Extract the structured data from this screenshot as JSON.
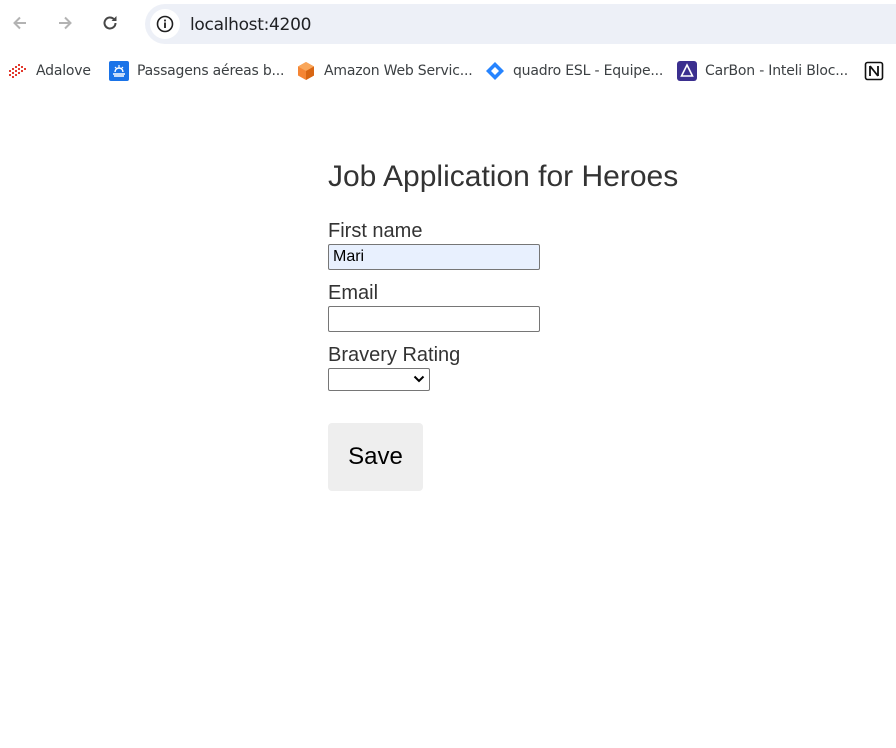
{
  "browser": {
    "url": "localhost:4200",
    "bookmarks": [
      {
        "label": "Adalove",
        "icon": "adalove-icon"
      },
      {
        "label": "Passagens aéreas b...",
        "icon": "flight-icon"
      },
      {
        "label": "Amazon Web Servic...",
        "icon": "aws-cube-icon"
      },
      {
        "label": "quadro ESL - Equipe...",
        "icon": "jira-diamond-icon"
      },
      {
        "label": "CarBon - Inteli Bloc...",
        "icon": "carbon-triangle-icon"
      },
      {
        "label": "",
        "icon": "notion-icon"
      }
    ]
  },
  "form": {
    "title": "Job Application for Heroes",
    "first_name_label": "First name",
    "first_name_value": "Mari",
    "email_label": "Email",
    "email_value": "",
    "bravery_label": "Bravery Rating",
    "bravery_value": "",
    "save_label": "Save"
  },
  "colors": {
    "autofill_bg": "#e8f0fe",
    "button_bg": "#eeeeee",
    "text": "#333333"
  }
}
